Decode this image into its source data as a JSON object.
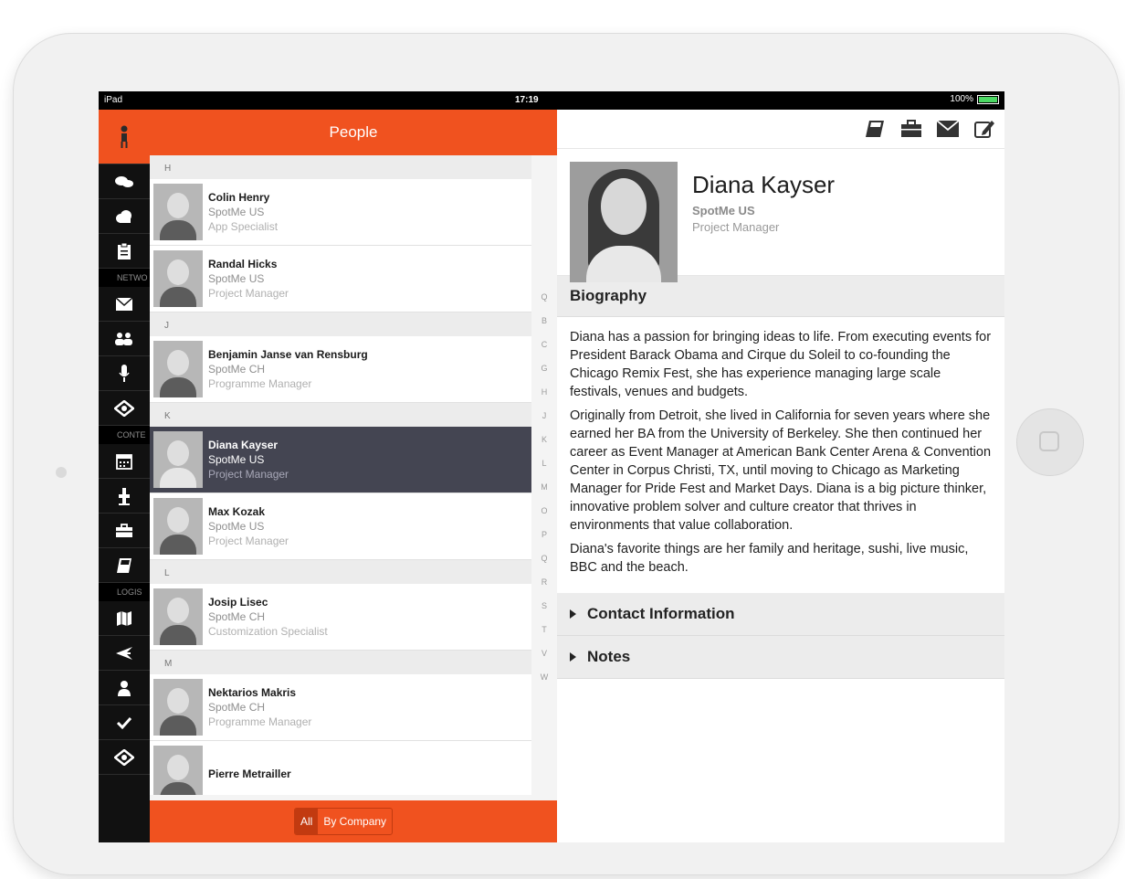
{
  "status_bar": {
    "carrier": "iPad",
    "time": "17:19",
    "battery": "100%"
  },
  "sidebar": {
    "sections": [
      "NETWO",
      "CONTE",
      "LOGIS"
    ],
    "icons": [
      "person-icon",
      "chat-icon",
      "cloud-icon",
      "clipboard-icon",
      "mail-icon",
      "group-icon",
      "mic-icon",
      "handshake-icon",
      "calendar-icon",
      "podium-icon",
      "briefcase-icon",
      "book-icon",
      "map-icon",
      "plane-icon",
      "user-icon",
      "check-icon",
      "settings-icon"
    ]
  },
  "list": {
    "title": "People",
    "groups": [
      {
        "letter": "H",
        "people": [
          {
            "name": "Colin Henry",
            "company": "SpotMe US",
            "role": "App Specialist"
          },
          {
            "name": "Randal Hicks",
            "company": "SpotMe US",
            "role": "Project Manager"
          }
        ]
      },
      {
        "letter": "J",
        "people": [
          {
            "name": "Benjamin Janse van Rensburg",
            "company": "SpotMe CH",
            "role": "Programme Manager"
          }
        ]
      },
      {
        "letter": "K",
        "people": [
          {
            "name": "Diana Kayser",
            "company": "SpotMe US",
            "role": "Project Manager",
            "selected": true
          },
          {
            "name": "Max Kozak",
            "company": "SpotMe US",
            "role": "Project Manager"
          }
        ]
      },
      {
        "letter": "L",
        "people": [
          {
            "name": "Josip Lisec",
            "company": "SpotMe CH",
            "role": "Customization Specialist"
          }
        ]
      },
      {
        "letter": "M",
        "people": [
          {
            "name": "Nektarios Makris",
            "company": "SpotMe CH",
            "role": "Programme Manager"
          },
          {
            "name": "Pierre Metrailler",
            "company": "",
            "role": ""
          }
        ]
      }
    ],
    "alpha_index": [
      "Q",
      "B",
      "C",
      "G",
      "H",
      "J",
      "K",
      "L",
      "M",
      "O",
      "P",
      "Q",
      "R",
      "S",
      "T",
      "V",
      "W"
    ],
    "footer": {
      "all_label": "All",
      "by_company_label": "By Company"
    }
  },
  "detail": {
    "toolbar_icons": [
      "book-icon",
      "briefcase-icon",
      "mail-icon",
      "edit-icon"
    ],
    "name": "Diana Kayser",
    "company": "SpotMe US",
    "role": "Project Manager",
    "biography_title": "Biography",
    "biography": [
      "Diana has a passion for bringing ideas to life. From executing events for President Barack Obama and Cirque du Soleil to co-founding the Chicago Remix Fest, she has experience managing large scale festivals, venues and budgets.",
      "Originally from Detroit, she lived in California for seven years where she earned her BA from the University of Berkeley. She then continued her career as Event Manager at American Bank Center Arena & Convention Center in Corpus Christi, TX, until moving to Chicago as Marketing Manager for Pride Fest and Market Days. Diana is a big picture thinker, innovative problem solver and culture creator that thrives in environments that value collaboration.",
      "Diana's favorite things are her family and heritage, sushi, live music, BBC and the beach."
    ],
    "contact_label": "Contact Information",
    "notes_label": "Notes"
  },
  "colors": {
    "accent": "#f0521f",
    "selected_row": "#444552",
    "sidebar": "#111111"
  }
}
